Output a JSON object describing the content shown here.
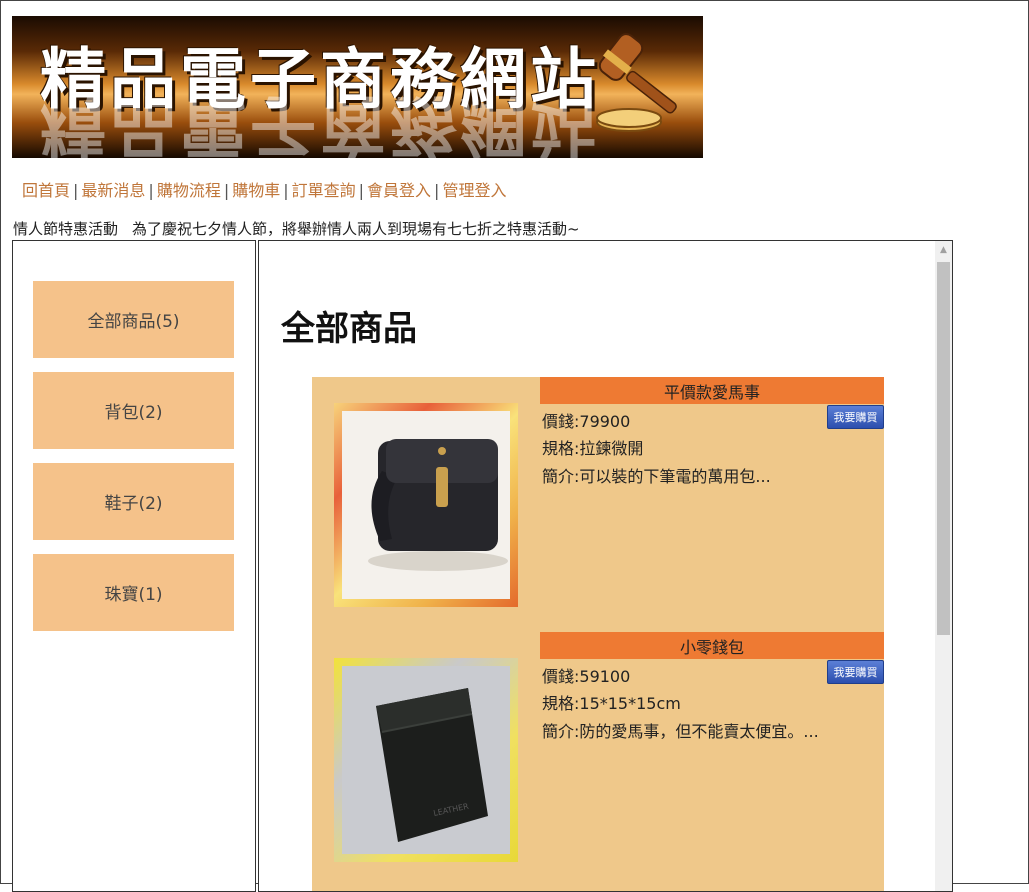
{
  "site": {
    "banner_title": "精品電子商務網站"
  },
  "nav": {
    "items": [
      {
        "label": "回首頁"
      },
      {
        "label": "最新消息"
      },
      {
        "label": "購物流程"
      },
      {
        "label": "購物車"
      },
      {
        "label": "訂單查詢"
      },
      {
        "label": "會員登入"
      },
      {
        "label": "管理登入"
      }
    ],
    "separator": "|"
  },
  "announcement": {
    "title": "情人節特惠活動",
    "text": "為了慶祝七夕情人節，將舉辦情人兩人到現場有七七折之特惠活動~"
  },
  "sidebar": {
    "categories": [
      {
        "label": "全部商品(5)"
      },
      {
        "label": "背包(2)"
      },
      {
        "label": "鞋子(2)"
      },
      {
        "label": "珠寶(1)"
      }
    ]
  },
  "main": {
    "title": "全部商品",
    "products": [
      {
        "name": "平價款愛馬事",
        "price": "價錢:79900",
        "spec": "規格:拉鍊微開",
        "desc": "簡介:可以裝的下筆電的萬用包...",
        "buy_label": "我要購買"
      },
      {
        "name": "小零錢包",
        "price": "價錢:59100",
        "spec": "規格:15*15*15cm",
        "desc": "簡介:防的愛馬事，但不能賣太便宜。...",
        "buy_label": "我要購買"
      }
    ]
  },
  "colors": {
    "nav_link": "#c0763a",
    "category_bg": "#f5c28a",
    "product_bg": "#efc88a",
    "product_name_bg": "#ee7a33",
    "buy_button": "#2c4fae"
  },
  "icons": {
    "banner": "gavel-icon",
    "scroll_up": "scroll-up-arrow-icon"
  }
}
